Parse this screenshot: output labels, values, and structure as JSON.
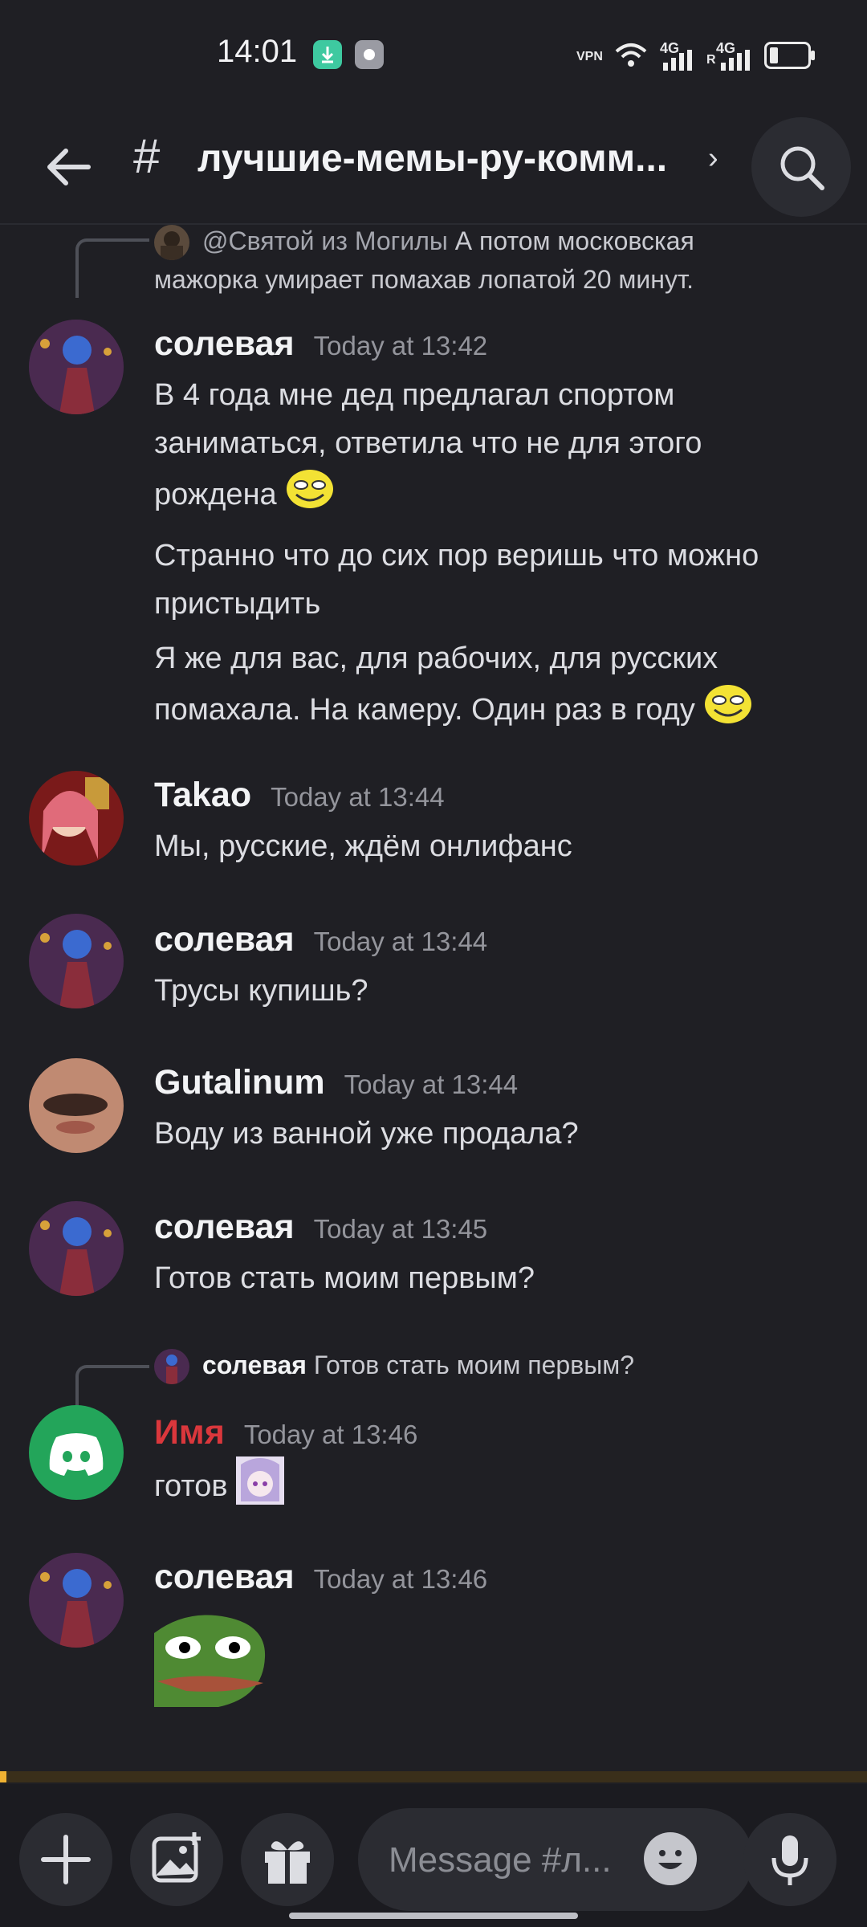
{
  "status_bar": {
    "time": "14:01",
    "vpn": "VPN",
    "net1": "4G",
    "net2": "4G",
    "roam": "R"
  },
  "header": {
    "hash": "#",
    "channel": "лучшие-мемы-ру-комм...",
    "chevron": "›"
  },
  "messages": [
    {
      "reply": {
        "author": "@Святой из Могилы",
        "text_line1": "А потом московская",
        "text_line2": "мажорка умирает помахав лопатой 20 минут."
      }
    },
    {
      "author": "солевая",
      "time": "Today at 13:42",
      "lines": [
        "В 4 года мне дед предлагал спортом",
        "заниматься, ответила что не для этого",
        "рождена",
        "Странно что до сих пор веришь что можно",
        "пристыдить",
        "Я же для вас, для рабочих, для русских",
        "помахала. На камеру. Один раз в году"
      ]
    },
    {
      "author": "Takao",
      "time": "Today at 13:44",
      "text": "Мы, русские, ждём онлифанс"
    },
    {
      "author": "солевая",
      "time": "Today at 13:44",
      "text": "Трусы купишь?"
    },
    {
      "author": "Gutalinum",
      "time": "Today at 13:44",
      "text": "Воду из ванной уже продала?"
    },
    {
      "author": "солевая",
      "time": "Today at 13:45",
      "text": "Готов стать моим первым?"
    },
    {
      "reply": {
        "author": "солевая",
        "text": "Готов стать моим первым?"
      },
      "author": "Имя",
      "author_color": "#da373c",
      "time": "Today at 13:46",
      "text": "готов"
    },
    {
      "author": "солевая",
      "time": "Today at 13:46",
      "attachment": "pepe-sticker"
    }
  ],
  "composer": {
    "placeholder": "Message #л..."
  },
  "colors": {
    "background": "#1f1f24",
    "discord_green": "#23a55a",
    "unread": "#f0b232"
  },
  "icons": [
    "back-arrow-icon",
    "search-icon",
    "plus-icon",
    "image-icon",
    "gift-icon",
    "emoji-icon",
    "microphone-icon",
    "discord-logo-icon"
  ]
}
